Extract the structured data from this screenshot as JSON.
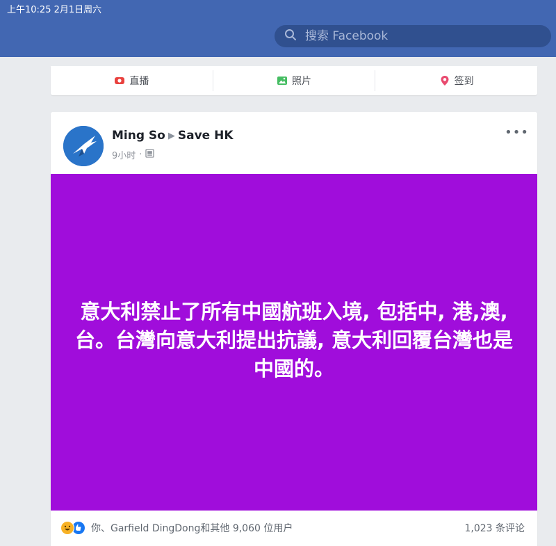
{
  "status_bar": {
    "time": "上午10:25   2月1日周六"
  },
  "search": {
    "placeholder": "搜索 Facebook"
  },
  "composer": {
    "live_label": "直播",
    "photo_label": "照片",
    "checkin_label": "签到"
  },
  "post": {
    "author": "Ming So",
    "target": "Save HK",
    "time": "9小时",
    "body": "意大利禁止了所有中國航班入境, 包括中, 港,澳,台。台灣向意大利提出抗議, 意大利回覆台灣也是中國的。",
    "card_color": "#a00ddb",
    "reactions_text": "你、Garfield DingDong和其他 9,060 位用户",
    "comments_text": "1,023 条评论"
  },
  "colors": {
    "header": "#4267b2",
    "accent": "#1877f2"
  },
  "icons": [
    "search-icon",
    "live-video-icon",
    "photo-icon",
    "location-pin-icon",
    "globe-privacy-icon",
    "more-options-icon",
    "haha-reaction-icon",
    "like-reaction-icon"
  ]
}
